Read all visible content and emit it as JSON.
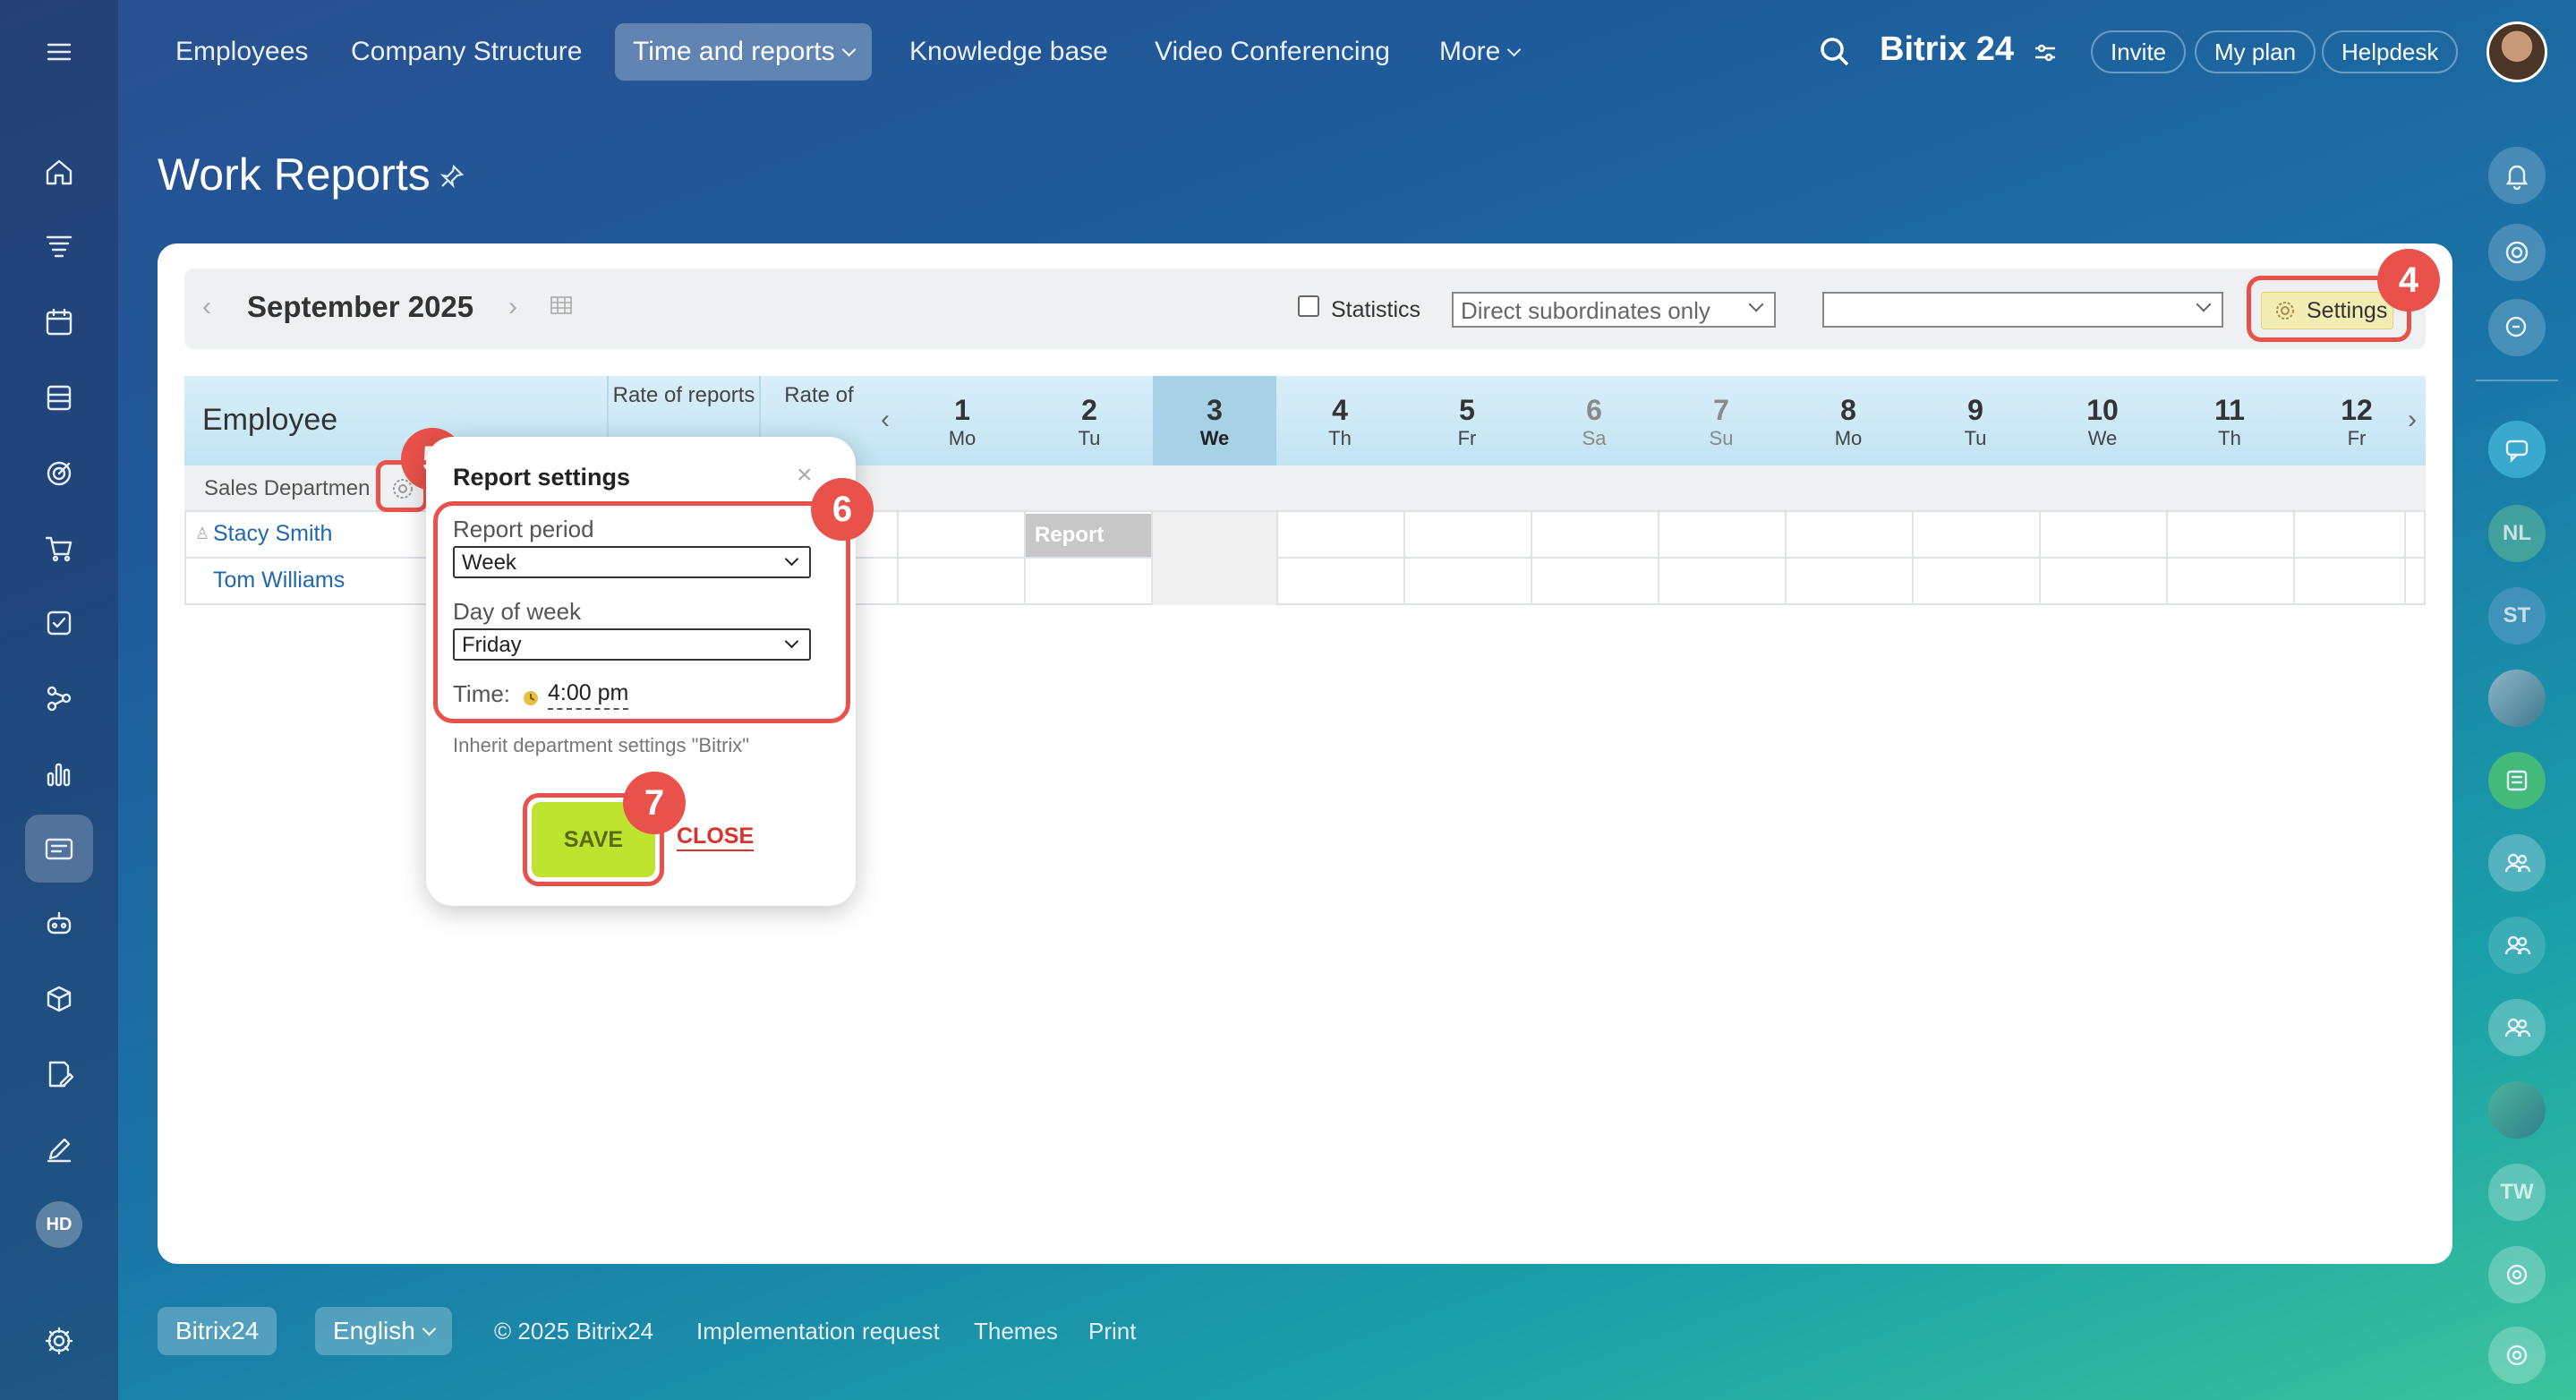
{
  "nav": {
    "items": [
      {
        "label": "Employees"
      },
      {
        "label": "Company Structure"
      },
      {
        "label": "Time and reports"
      },
      {
        "label": "Knowledge base"
      },
      {
        "label": "Video Conferencing"
      },
      {
        "label": "More"
      }
    ],
    "brand": "Bitrix 24",
    "invite": "Invite",
    "my_plan": "My plan",
    "helpdesk": "Helpdesk"
  },
  "sidebar": {
    "icons": [
      "home-icon",
      "filter-icon",
      "calendar-icon",
      "building-icon",
      "target-icon",
      "cart-icon",
      "checkbox-icon",
      "flow-icon",
      "chart-icon",
      "reports-icon",
      "robot-icon",
      "box-icon",
      "document-edit-icon",
      "pencil-icon"
    ],
    "avatar": "HD"
  },
  "page": {
    "title": "Work Reports"
  },
  "toolbar": {
    "month": "September 2025",
    "statistics_label": "Statistics",
    "subordinates": "Direct subordinates only",
    "second_filter": "",
    "settings": "Settings"
  },
  "table": {
    "employee_header": "Employee",
    "rate_reports": "Rate of reports",
    "rate_positive": "Rate of positive",
    "department": "Sales Departmen",
    "employees": [
      "Stacy Smith",
      "Tom Williams"
    ],
    "days": [
      {
        "num": "1",
        "name": "Mo"
      },
      {
        "num": "2",
        "name": "Tu"
      },
      {
        "num": "3",
        "name": "We"
      },
      {
        "num": "4",
        "name": "Th"
      },
      {
        "num": "5",
        "name": "Fr"
      },
      {
        "num": "6",
        "name": "Sa"
      },
      {
        "num": "7",
        "name": "Su"
      },
      {
        "num": "8",
        "name": "Mo"
      },
      {
        "num": "9",
        "name": "Tu"
      },
      {
        "num": "10",
        "name": "We"
      },
      {
        "num": "11",
        "name": "Th"
      },
      {
        "num": "12",
        "name": "Fr"
      }
    ],
    "report_badge": "Report"
  },
  "popup": {
    "title": "Report settings",
    "period_label": "Report period",
    "period_value": "Week",
    "dow_label": "Day of week",
    "dow_value": "Friday",
    "time_label": "Time:",
    "time_value": "4:00 pm",
    "inherit": "Inherit department settings \"Bitrix\"",
    "save": "SAVE",
    "close": "CLOSE"
  },
  "markers": [
    "4",
    "5",
    "6",
    "7"
  ],
  "rightrail": [
    "NL",
    "ST",
    "TW"
  ],
  "footer": {
    "brand": "Bitrix24",
    "language": "English",
    "copyright": "© 2025 Bitrix24",
    "implementation": "Implementation request",
    "themes": "Themes",
    "print": "Print"
  },
  "colors": {
    "accent_marker": "#e8524a",
    "save_button": "#bfe430",
    "header_row": "#cfe9f5",
    "link": "#2067b0"
  }
}
